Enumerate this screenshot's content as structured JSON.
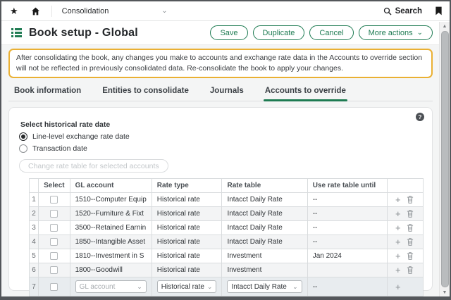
{
  "colors": {
    "accent_green": "#1e7b52",
    "warning_border": "#eab033"
  },
  "topbar": {
    "app_label": "Consolidation",
    "search_label": "Search"
  },
  "header": {
    "title": "Book setup - Global",
    "save": "Save",
    "duplicate": "Duplicate",
    "cancel": "Cancel",
    "more_actions": "More actions"
  },
  "warning": {
    "text": "After consolidating the book, any changes you make to accounts and exchange rate data in the Accounts to override section will not be reflected in previously consolidated data. Re-consolidate the book to apply your changes."
  },
  "tabs": [
    {
      "label": "Book information",
      "active": false
    },
    {
      "label": "Entities to consolidate",
      "active": false
    },
    {
      "label": "Journals",
      "active": false
    },
    {
      "label": "Accounts to override",
      "active": true
    }
  ],
  "rate_section": {
    "label": "Select historical rate date",
    "options": [
      {
        "label": "Line-level exchange rate date",
        "selected": true
      },
      {
        "label": "Transaction date",
        "selected": false
      }
    ],
    "change_button": "Change rate table for selected accounts"
  },
  "table": {
    "columns": [
      "Select",
      "GL account",
      "Rate type",
      "Rate table",
      "Use rate table until"
    ],
    "rows": [
      {
        "num": "1",
        "gl_account": "1510--Computer Equip",
        "rate_type": "Historical rate",
        "rate_table": "Intacct Daily Rate",
        "use_until": "--"
      },
      {
        "num": "2",
        "gl_account": "1520--Furniture & Fixt",
        "rate_type": "Historical rate",
        "rate_table": "Intacct Daily Rate",
        "use_until": "--"
      },
      {
        "num": "3",
        "gl_account": "3500--Retained Earnin",
        "rate_type": "Historical rate",
        "rate_table": "Intacct Daily Rate",
        "use_until": "--"
      },
      {
        "num": "4",
        "gl_account": "1850--Intangible Asset",
        "rate_type": "Historical rate",
        "rate_table": "Intacct Daily Rate",
        "use_until": "--"
      },
      {
        "num": "5",
        "gl_account": "1810--Investment in S",
        "rate_type": "Historical rate",
        "rate_table": "Investment",
        "use_until": "Jan 2024"
      },
      {
        "num": "6",
        "gl_account": "1800--Goodwill",
        "rate_type": "Historical rate",
        "rate_table": "Investment",
        "use_until": ""
      }
    ],
    "new_row": {
      "num": "7",
      "gl_placeholder": "GL account",
      "rate_type": "Historical rate",
      "rate_table": "Intacct Daily Rate",
      "use_until": "--"
    }
  }
}
